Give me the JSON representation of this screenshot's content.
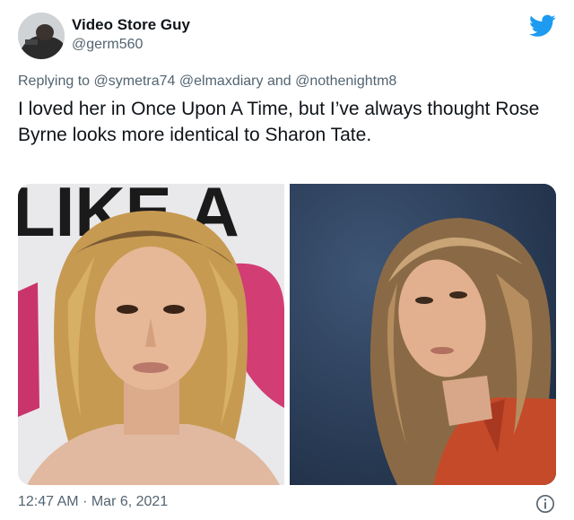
{
  "author": {
    "name": "Video Store Guy",
    "handle": "@germ560"
  },
  "reply": {
    "prefix": "Replying to",
    "mentions": [
      "@symetra74",
      "@elmaxdiary",
      "@nothenightm8"
    ],
    "joiner": "and"
  },
  "tweet": {
    "text": "I loved her in Once Upon A Time, but I’ve always thought Rose Byrne looks more identical to Sharon Tate."
  },
  "media": {
    "left_photo": {
      "backdrop_letters": "LIKE A"
    },
    "right_photo": {}
  },
  "footer": {
    "time": "12:47 AM",
    "separator": "·",
    "date": "Mar 6, 2021"
  },
  "icons": {
    "brand": "twitter-bird-icon",
    "info": "info-icon"
  },
  "colors": {
    "brand": "#1d9bf0",
    "secondary_text": "#536471",
    "primary_text": "#0f1419"
  }
}
